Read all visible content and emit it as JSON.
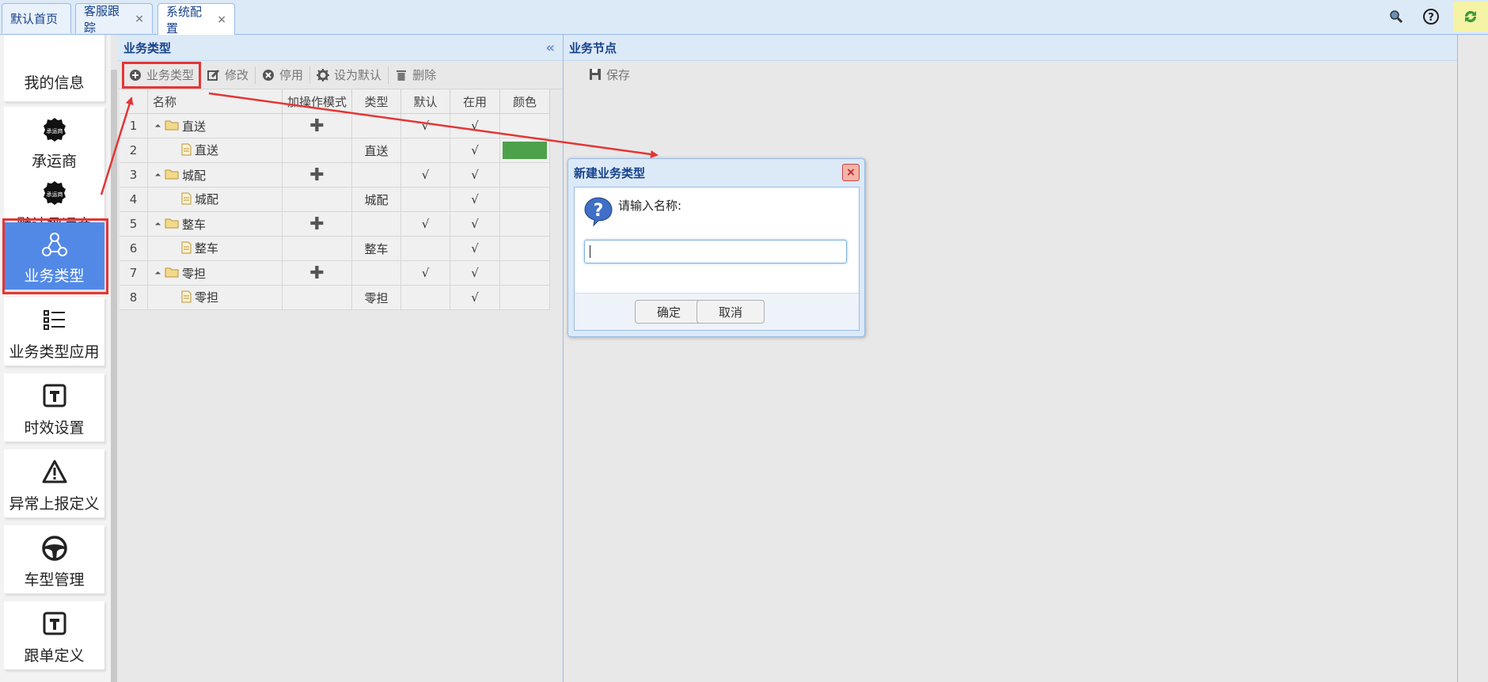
{
  "tabs": [
    {
      "label": "默认首页",
      "closable": false
    },
    {
      "label": "客服跟踪",
      "closable": true
    },
    {
      "label": "系统配置",
      "closable": true,
      "active": true
    }
  ],
  "tab_close_glyph": "×",
  "top_icons": [
    "search-icon",
    "help-icon",
    "refresh-icon"
  ],
  "sidebar": {
    "items": [
      {
        "label": "我的信息",
        "icon": "none"
      },
      {
        "label": "承运商",
        "icon": "carrier-badge-icon"
      },
      {
        "label": "默认承运商",
        "icon": "carrier-badge-icon"
      },
      {
        "label": "业务类型",
        "icon": "network-icon",
        "selected": true
      },
      {
        "label": "业务类型应用",
        "icon": "list-icon"
      },
      {
        "label": "时效设置",
        "icon": "t-square-icon"
      },
      {
        "label": "异常上报定义",
        "icon": "warning-icon"
      },
      {
        "label": "车型管理",
        "icon": "steering-wheel-icon"
      },
      {
        "label": "跟单定义",
        "icon": "t-square-icon"
      }
    ],
    "badge_text": "承运商"
  },
  "left_panel": {
    "title": "业务类型",
    "toolbar": {
      "add": "业务类型",
      "edit": "修改",
      "disable": "停用",
      "set_default": "设为默认",
      "delete": "删除"
    },
    "columns": [
      "名称",
      "加操作模式",
      "类型",
      "默认",
      "在用",
      "颜色"
    ],
    "rows": [
      {
        "n": "1",
        "name": "直送",
        "kind": "folder",
        "plus": true,
        "type": "",
        "default": "√",
        "active": "√",
        "color": ""
      },
      {
        "n": "2",
        "name": "直送",
        "kind": "file",
        "plus": false,
        "type": "直送",
        "default": "",
        "active": "√",
        "color": "#4da14a"
      },
      {
        "n": "3",
        "name": "城配",
        "kind": "folder",
        "plus": true,
        "type": "",
        "default": "√",
        "active": "√",
        "color": ""
      },
      {
        "n": "4",
        "name": "城配",
        "kind": "file",
        "plus": false,
        "type": "城配",
        "default": "",
        "active": "√",
        "color": ""
      },
      {
        "n": "5",
        "name": "整车",
        "kind": "folder",
        "plus": true,
        "type": "",
        "default": "√",
        "active": "√",
        "color": ""
      },
      {
        "n": "6",
        "name": "整车",
        "kind": "file",
        "plus": false,
        "type": "整车",
        "default": "",
        "active": "√",
        "color": ""
      },
      {
        "n": "7",
        "name": "零担",
        "kind": "folder",
        "plus": true,
        "type": "",
        "default": "√",
        "active": "√",
        "color": ""
      },
      {
        "n": "8",
        "name": "零担",
        "kind": "file",
        "plus": false,
        "type": "零担",
        "default": "",
        "active": "√",
        "color": ""
      }
    ],
    "plus_glyph": "✚",
    "collapse_glyph": "«"
  },
  "right_panel": {
    "title": "业务节点",
    "save": "保存"
  },
  "dialog": {
    "title": "新建业务类型",
    "prompt": "请输入名称:",
    "input_value": "",
    "ok": "确定",
    "cancel": "取消",
    "close_glyph": "×",
    "question_glyph": "?"
  },
  "colors": {
    "accent": "#5289e7",
    "highlight": "#e53535",
    "header_blue": "#15428b"
  }
}
